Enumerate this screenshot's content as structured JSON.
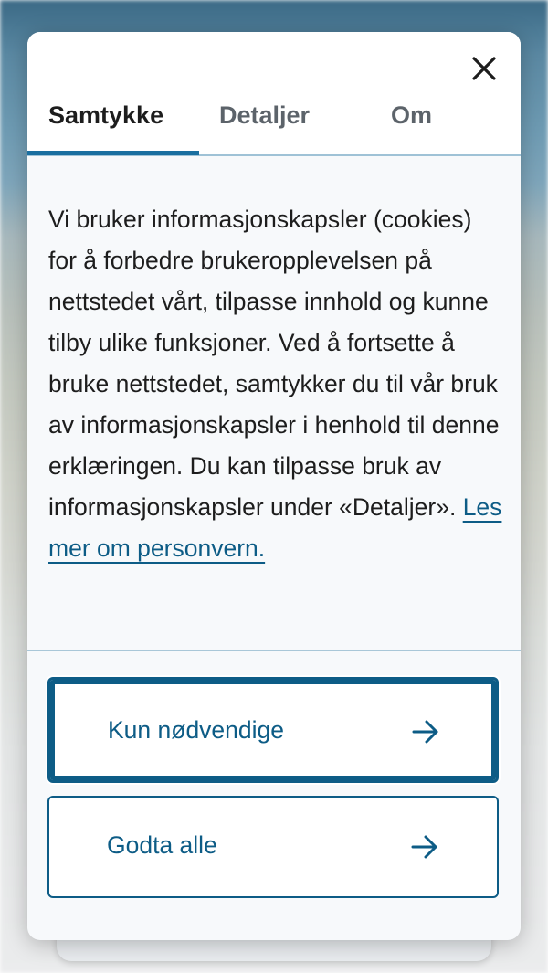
{
  "dialog": {
    "close_icon": "close-icon",
    "tabs": [
      {
        "label": "Samtykke",
        "active": true
      },
      {
        "label": "Detaljer",
        "active": false
      },
      {
        "label": "Om",
        "active": false
      }
    ],
    "body": {
      "text": "Vi bruker informasjonskapsler (cookies) for å forbedre brukeropplevelsen på nettstedet vårt, tilpasse innhold og kunne tilby ulike funksjoner. Ved å fortsette å bruke nettstedet, samtykker du til vår bruk av informasjonskapsler i henhold til denne erklæringen. Du kan tilpasse bruk av informasjonskapsler under «Detaljer».",
      "link_label": "Les mer om personvern."
    },
    "buttons": {
      "necessary_label": "Kun nødvendige",
      "accept_all_label": "Godta alle",
      "arrow_icon": "arrow-right-icon"
    }
  },
  "colors": {
    "accent": "#1a6fa0",
    "link": "#0d5c86",
    "text": "#1d1d1d",
    "inactive_tab": "#5c636a"
  }
}
